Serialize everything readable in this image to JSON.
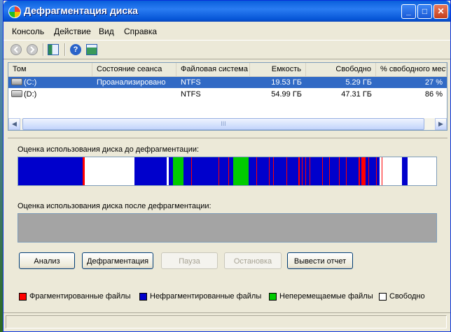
{
  "window": {
    "title": "Дефрагментация диска"
  },
  "menu": [
    "Консоль",
    "Действие",
    "Вид",
    "Справка"
  ],
  "toolbar": {
    "icons": [
      "back-icon",
      "forward-icon",
      "show-hide-tree-icon",
      "help-icon",
      "properties-icon"
    ]
  },
  "volumes": {
    "columns": [
      "Том",
      "Состояние сеанса",
      "Файловая система",
      "Емкость",
      "Свободно",
      "% свободного мест"
    ],
    "rows": [
      {
        "volume": "(C:)",
        "status": "Проанализировано",
        "fs": "NTFS",
        "capacity": "19.53 ГБ",
        "free": "5.29 ГБ",
        "pct": "27 %",
        "selected": true
      },
      {
        "volume": "(D:)",
        "status": "",
        "fs": "NTFS",
        "capacity": "54.99 ГБ",
        "free": "47.31 ГБ",
        "pct": "86 %",
        "selected": false
      }
    ],
    "scroll_grip": "III"
  },
  "analysis": {
    "before_label": "Оценка использования диска до дефрагментации:",
    "after_label": "Оценка использования диска после дефрагментации:"
  },
  "buttons": {
    "analyze": "Анализ",
    "defragment": "Дефрагментация",
    "pause": "Пауза",
    "stop": "Остановка",
    "report": "Вывести отчет"
  },
  "legend": {
    "fragmented": "Фрагментированные файлы",
    "contiguous": "Нефрагментированные файлы",
    "unmovable": "Неперемещаемые файлы",
    "free": "Свободно"
  },
  "colors": {
    "fragmented": "#ff0000",
    "contiguous": "#0000cc",
    "unmovable": "#00cc00",
    "free": "#ffffff",
    "after_empty": "#a4a4a4"
  }
}
